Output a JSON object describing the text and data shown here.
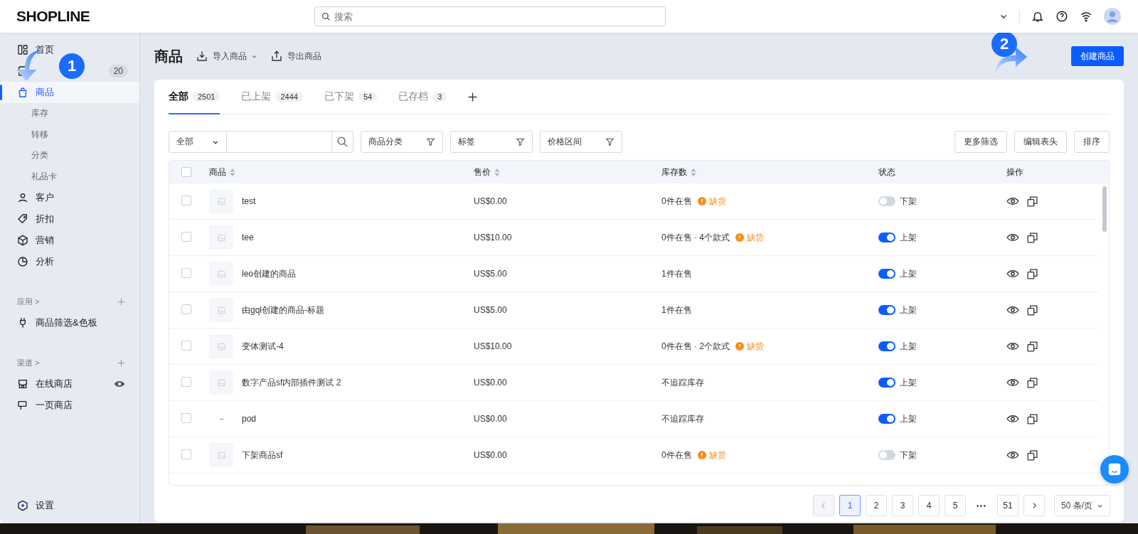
{
  "header": {
    "logo": "SHOPLINE",
    "search": {
      "placeholder": "搜索"
    }
  },
  "sidebar": {
    "items": [
      {
        "label": "首页",
        "selected": false
      },
      {
        "selected": false,
        "badge": "20"
      },
      {
        "label": "商品",
        "selected": true,
        "children": [
          {
            "label": "库存"
          },
          {
            "label": "转移"
          },
          {
            "label": "分类"
          },
          {
            "label": "礼品卡"
          }
        ]
      },
      {
        "label": "客户",
        "selected": false
      },
      {
        "label": "折扣",
        "selected": false
      },
      {
        "label": "营销",
        "selected": false
      },
      {
        "label": "分析",
        "selected": false
      }
    ],
    "sections": [
      {
        "title": "应用 >",
        "items": [
          {
            "label": "商品筛选&色板",
            "eye": false
          }
        ]
      },
      {
        "title": "渠道 >",
        "items": [
          {
            "label": "在线商店",
            "eye": true
          },
          {
            "label": "一页商店",
            "eye": false
          }
        ]
      }
    ],
    "settings": "设置"
  },
  "page": {
    "title": "商品",
    "actions": [
      {
        "label": "导入商品",
        "dropdown": true
      },
      {
        "label": "导出商品",
        "dropdown": false
      }
    ],
    "primary_button": "创建商品"
  },
  "tabs": [
    {
      "label": "全部",
      "count": "2501",
      "selected": true
    },
    {
      "label": "已上架",
      "count": "2444",
      "selected": false
    },
    {
      "label": "已下架",
      "count": "54",
      "selected": false
    },
    {
      "label": "已存档",
      "count": "3",
      "selected": false
    }
  ],
  "filters": {
    "scope": "全部",
    "dropdowns": [
      "商品分类",
      "标签",
      "价格区间"
    ],
    "buttons": [
      "更多筛选",
      "编辑表头",
      "排序"
    ]
  },
  "table": {
    "all_checked": false,
    "columns": [
      {
        "label": "商品",
        "sortable": true
      },
      {
        "label": "售价",
        "sortable": true
      },
      {
        "label": "库存数",
        "sortable": true
      },
      {
        "label": "状态",
        "sortable": false
      },
      {
        "label": "操作",
        "sortable": false
      }
    ],
    "rows": [
      {
        "checked": false,
        "name": "test",
        "thumb": true,
        "price": "US$0.00",
        "stock": "0件在售",
        "warning": "缺货",
        "on": false,
        "status": "下架"
      },
      {
        "checked": false,
        "name": "tee",
        "thumb": true,
        "price": "US$10.00",
        "stock": "0件在售 · 4个款式",
        "warning": "缺货",
        "on": true,
        "status": "上架"
      },
      {
        "checked": false,
        "name": "leo创建的商品",
        "thumb": true,
        "price": "US$5.00",
        "stock": "1件在售",
        "on": true,
        "status": "上架"
      },
      {
        "checked": false,
        "name": "由gql创建的商品-标题",
        "thumb": true,
        "price": "US$5.00",
        "stock": "1件在售",
        "on": true,
        "status": "上架"
      },
      {
        "checked": false,
        "name": "变体测试-4",
        "thumb": true,
        "price": "US$10.00",
        "stock": "0件在售 · 2个款式",
        "warning": "缺货",
        "on": true,
        "status": "上架"
      },
      {
        "checked": false,
        "name": "数字产品sf内部插件测试 2",
        "thumb": true,
        "price": "US$0.00",
        "stock": "不追踪库存",
        "on": true,
        "status": "上架"
      },
      {
        "checked": false,
        "name": "pod",
        "thumb": false,
        "price": "US$0.00",
        "stock": "不追踪库存",
        "on": true,
        "status": "上架"
      },
      {
        "checked": false,
        "name": "下架商品sf",
        "thumb": true,
        "price": "US$0.00",
        "stock": "0件在售",
        "warning": "缺货",
        "on": false,
        "status": "下架"
      }
    ]
  },
  "pagination": {
    "pages": [
      {
        "label": "1",
        "selected": true
      },
      {
        "label": "2",
        "selected": false
      },
      {
        "label": "3",
        "selected": false
      },
      {
        "label": "4",
        "selected": false
      },
      {
        "label": "5",
        "selected": false
      }
    ],
    "ellipsis": "•••",
    "last_page": "51",
    "page_size": "50 条/页"
  },
  "step_markers": [
    {
      "label": "1"
    },
    {
      "label": "2"
    }
  ]
}
